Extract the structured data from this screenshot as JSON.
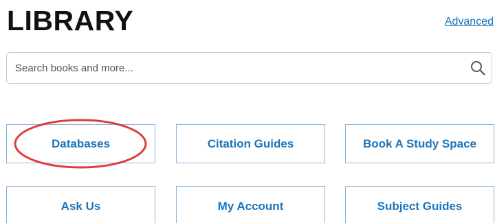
{
  "header": {
    "title": "LIBRARY",
    "advanced_link": "Advanced"
  },
  "search": {
    "placeholder": "Search books and more...",
    "value": "",
    "icon": "search-icon"
  },
  "tiles": [
    {
      "label": "Databases",
      "highlighted": true
    },
    {
      "label": "Citation Guides"
    },
    {
      "label": "Book A Study Space"
    },
    {
      "label": "Ask Us"
    },
    {
      "label": "My Account"
    },
    {
      "label": "Subject Guides"
    }
  ],
  "colors": {
    "accent": "#1b75bc",
    "tile_border": "#8ab4d9",
    "highlight": "#e03a3a",
    "title": "#111111"
  }
}
